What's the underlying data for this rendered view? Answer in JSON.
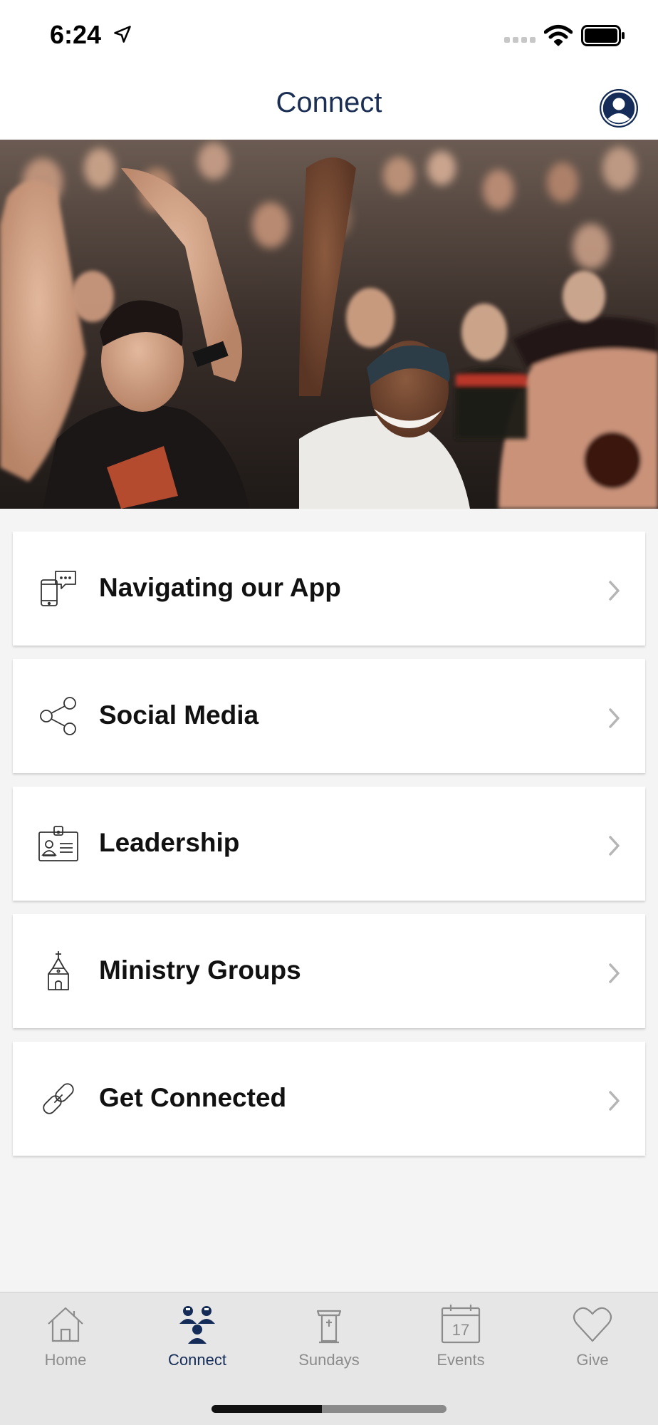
{
  "status_bar": {
    "time": "6:24"
  },
  "header": {
    "title": "Connect",
    "profile_icon": "person-circle-icon"
  },
  "hero": {
    "alt": "crowd-photo"
  },
  "menu": {
    "items": [
      {
        "label": "Navigating our App",
        "icon": "phone-chat-icon"
      },
      {
        "label": "Social Media",
        "icon": "share-icon"
      },
      {
        "label": "Leadership",
        "icon": "id-badge-icon"
      },
      {
        "label": "Ministry Groups",
        "icon": "church-icon"
      },
      {
        "label": "Get Connected",
        "icon": "link-icon"
      }
    ]
  },
  "tabs": [
    {
      "label": "Home",
      "icon": "home-icon",
      "active": false
    },
    {
      "label": "Connect",
      "icon": "people-icon",
      "active": true
    },
    {
      "label": "Sundays",
      "icon": "pulpit-icon",
      "active": false
    },
    {
      "label": "Events",
      "icon": "calendar-icon",
      "active": false,
      "badge": "17"
    },
    {
      "label": "Give",
      "icon": "heart-icon",
      "active": false
    }
  ],
  "colors": {
    "brand_navy": "#142c57",
    "title_navy": "#1b2f55",
    "inactive_tab": "#8c8c8c",
    "background": "#f4f4f4"
  }
}
